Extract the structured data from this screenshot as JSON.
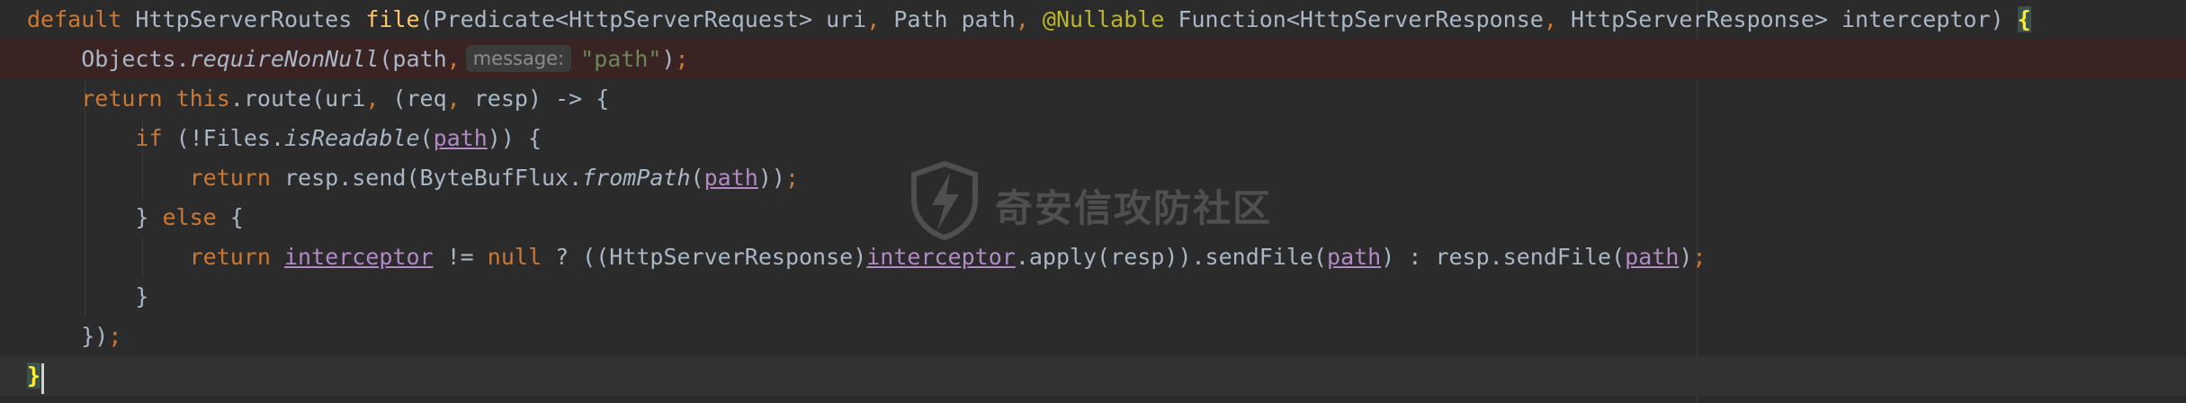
{
  "watermark": {
    "text": "奇安信攻防社区"
  },
  "code": {
    "l1": {
      "kw_default": "default",
      "type_routes": "HttpServerRoutes",
      "method_file": "file",
      "p_open": "(Predicate<HttpServerRequest> uri",
      "comma1": ",",
      "p_path": " Path path",
      "comma2": ",",
      "annotation": " @Nullable",
      "p_func": " Function<HttpServerResponse",
      "comma3": ",",
      "p_func2": " HttpServerResponse> interceptor) ",
      "brace": "{"
    },
    "l2": {
      "objects": "Objects.",
      "method": "requireNonNull",
      "args": "(path",
      "comma": ",",
      "hint": "message:",
      "str": "\"path\"",
      "end": ")",
      "semi": ";"
    },
    "l3": {
      "kw_return": "return",
      "kw_this": " this",
      "route": ".route(uri",
      "comma1": ",",
      "lambda": " (req",
      "comma2": ",",
      "rest": " resp) -> {"
    },
    "l4": {
      "kw_if": "if",
      "cond": " (!Files.",
      "method": "isReadable",
      "open": "(",
      "param": "path",
      "close": ")) {"
    },
    "l5": {
      "kw_return": "return",
      "call": " resp.send(ByteBufFlux.",
      "method": "fromPath",
      "open": "(",
      "param": "path",
      "close": "))",
      "semi": ";"
    },
    "l6": {
      "close": "} ",
      "kw_else": "else",
      "open": " {"
    },
    "l7": {
      "kw_return": "return",
      "sp": " ",
      "param1": "interceptor",
      "neq": " != ",
      "kw_null": "null",
      "tern": " ? ((HttpServerResponse)",
      "param2": "interceptor",
      "apply": ".apply(resp)).sendFile(",
      "param3": "path",
      "colon": ") : resp.sendFile(",
      "param4": "path",
      "close": ")",
      "semi": ";"
    },
    "l8": {
      "close": "}"
    },
    "l9": {
      "close": "})",
      "semi": ";"
    },
    "l10": {
      "brace": "}"
    }
  }
}
